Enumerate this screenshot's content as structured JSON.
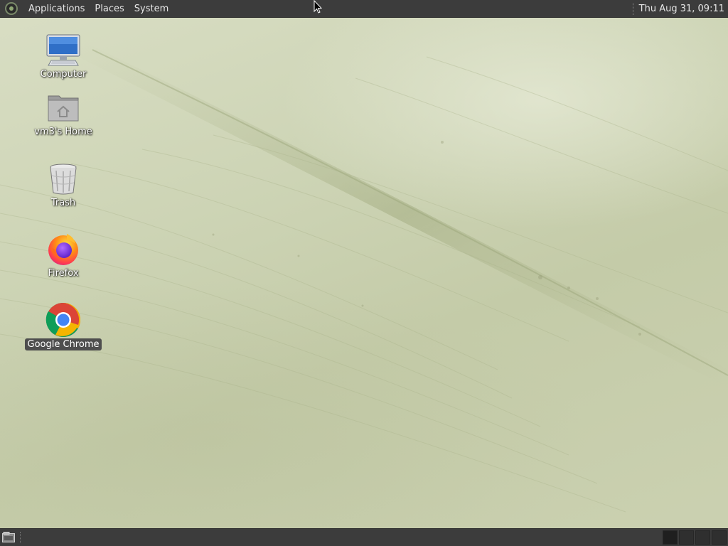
{
  "top_panel": {
    "menus": [
      "Applications",
      "Places",
      "System"
    ],
    "clock": "Thu Aug 31, 09:11"
  },
  "desktop": {
    "icons": [
      {
        "label": "Computer",
        "icon": "computer-icon",
        "selected": false
      },
      {
        "label": "vm3's Home",
        "icon": "home-folder-icon",
        "selected": false
      },
      {
        "label": "Trash",
        "icon": "trash-icon",
        "selected": false
      },
      {
        "label": "Firefox",
        "icon": "firefox-icon",
        "selected": false
      },
      {
        "label": "Google Chrome",
        "icon": "chrome-icon",
        "selected": true
      }
    ]
  },
  "bottom_panel": {
    "show_desktop_icon": "show-desktop-icon",
    "workspace_count": 4
  },
  "colors": {
    "panel": "#3c3c3c",
    "wallpaper": "#cdd4b5",
    "selection": "#4e4e4e"
  }
}
